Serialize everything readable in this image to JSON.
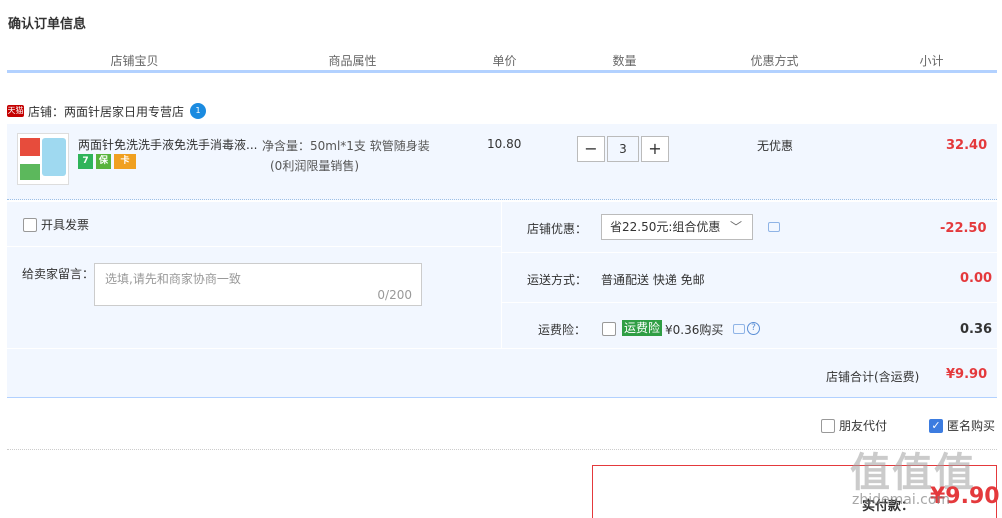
{
  "page_title": "确认订单信息",
  "columns": [
    "店铺宝贝",
    "商品属性",
    "单价",
    "数量",
    "优惠方式",
    "小计"
  ],
  "shop": {
    "badge": "天猫",
    "name": "店铺：两面针居家日用专营店",
    "chat_badge": "1"
  },
  "item": {
    "title": "两面针免洗洗手液免洗手消毒液...",
    "attr_line1": "净含量：50ml*1支 软管随身装",
    "attr_line2": "(0利润限量销售)",
    "unit_price": "10.80",
    "qty_minus": "−",
    "qty_value": "3",
    "qty_plus": "+",
    "discount": "无优惠",
    "subtotal": "32.40",
    "service_icons": [
      "7",
      "保",
      "卡"
    ]
  },
  "invoice_label": "开具发票",
  "message": {
    "label": "给卖家留言：",
    "placeholder": "选填,请先和商家协商一致",
    "count": "0/200"
  },
  "shop_discount": {
    "label": "店铺优惠：",
    "selected": "省22.50元:组合优惠",
    "chevron": "﹀",
    "value": "-22.50"
  },
  "shipping": {
    "label": "运送方式：",
    "value": "普通配送 快递 免邮",
    "price": "0.00"
  },
  "insurance": {
    "label": "运费险：",
    "tag": "运费险",
    "buy": "¥0.36购买",
    "help": "?",
    "price": "0.36"
  },
  "shop_total": {
    "label": "店铺合计(含运费)",
    "value": "¥9.90"
  },
  "options": {
    "friend_pay": "朋友代付",
    "anonymous": "匿名购买",
    "check_mark": "✓"
  },
  "payment": {
    "label": "实付款：",
    "amount": "¥9.90"
  },
  "watermark": {
    "main": "值值值",
    "sub": "zhidemai.com"
  },
  "colors": {
    "accent_red": "#e4393c",
    "panel_blue": "#f2f7ff",
    "header_line": "#b2d1ff",
    "insurance_green": "#2f9e44",
    "checkbox_blue": "#3c7ce0"
  }
}
